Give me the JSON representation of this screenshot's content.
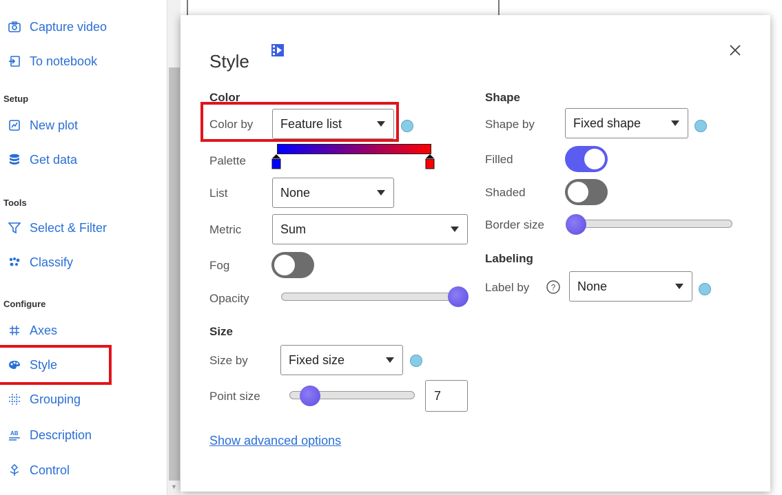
{
  "sidebar": {
    "items_top": [
      {
        "label": "Capture video",
        "icon": "camera-icon"
      },
      {
        "label": "To notebook",
        "icon": "notebook-export-icon"
      }
    ],
    "setup_heading": "Setup",
    "setup_items": [
      {
        "label": "New plot",
        "icon": "new-plot-icon"
      },
      {
        "label": "Get data",
        "icon": "database-icon"
      }
    ],
    "tools_heading": "Tools",
    "tools_items": [
      {
        "label": "Select & Filter",
        "icon": "filter-icon"
      },
      {
        "label": "Classify",
        "icon": "classify-icon"
      }
    ],
    "configure_heading": "Configure",
    "configure_items": [
      {
        "label": "Axes",
        "icon": "grid-icon"
      },
      {
        "label": "Style",
        "icon": "palette-icon"
      },
      {
        "label": "Grouping",
        "icon": "grouping-icon"
      },
      {
        "label": "Description",
        "icon": "description-icon"
      },
      {
        "label": "Control",
        "icon": "control-icon"
      }
    ]
  },
  "dialog": {
    "title": "Style",
    "close_icon": "close-icon",
    "video_icon": "video-icon",
    "color": {
      "heading": "Color",
      "color_by_label": "Color by",
      "color_by_value": "Feature list",
      "palette_label": "Palette",
      "palette_start": "#0000ff",
      "palette_end": "#ff0000",
      "list_label": "List",
      "list_value": "None",
      "metric_label": "Metric",
      "metric_value": "Sum",
      "fog_label": "Fog",
      "fog_on": false,
      "opacity_label": "Opacity",
      "opacity_value": 1.0
    },
    "size": {
      "heading": "Size",
      "size_by_label": "Size by",
      "size_by_value": "Fixed size",
      "point_size_label": "Point size",
      "point_size_value": "7"
    },
    "advanced_link": "Show advanced options",
    "shape": {
      "heading": "Shape",
      "shape_by_label": "Shape by",
      "shape_by_value": "Fixed shape",
      "filled_label": "Filled",
      "filled_on": true,
      "shaded_label": "Shaded",
      "shaded_on": false,
      "border_size_label": "Border size",
      "border_size_value": 0
    },
    "labeling": {
      "heading": "Labeling",
      "label_by_label": "Label by",
      "label_by_value": "None"
    }
  },
  "colors": {
    "accent": "#2a6fd6",
    "toggle_on": "#5b5cf0",
    "toggle_off": "#6d6d6d",
    "highlight": "#e0141a"
  }
}
